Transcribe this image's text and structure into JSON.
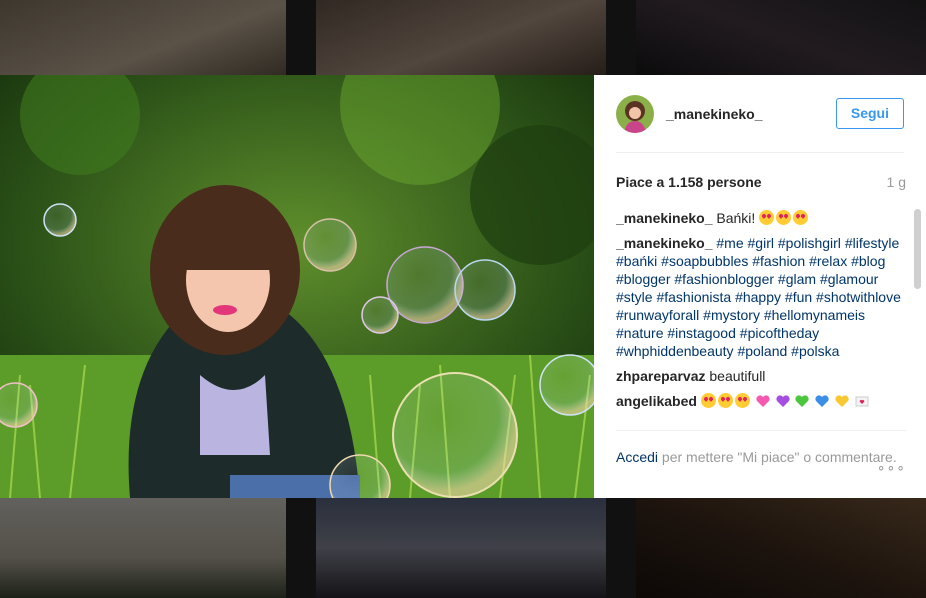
{
  "post": {
    "username": "_manekineko_",
    "follow_label": "Segui",
    "likes": "Piace a 1.158 persone",
    "time": "1 g"
  },
  "comments": [
    {
      "user": "_manekineko_",
      "text": "Bańki!",
      "emoji": [
        "face-heart-eyes",
        "face-heart-eyes",
        "face-heart-eyes"
      ]
    },
    {
      "user": "_manekineko_",
      "tags": [
        "#me",
        "#girl",
        "#polishgirl",
        "#lifestyle",
        "#bańki",
        "#soapbubbles",
        "#fashion",
        "#relax",
        "#blog",
        "#blogger",
        "#fashionblogger",
        "#glam",
        "#glamour",
        "#style",
        "#fashionista",
        "#happy",
        "#fun",
        "#shotwithlove",
        "#runwayforall",
        "#mystory",
        "#hellomynameis",
        "#nature",
        "#instagood",
        "#picoftheday",
        "#whphiddenbeauty",
        "#poland",
        "#polska"
      ]
    },
    {
      "user": "zhpareparvaz",
      "text": "beautifull"
    },
    {
      "user": "angelikabed",
      "emoji": [
        "face-heart-eyes",
        "face-heart-eyes",
        "face-heart-eyes",
        "sparkle-heart",
        "purple-heart",
        "green-heart",
        "blue-heart",
        "yellow-heart",
        "love-letter"
      ]
    }
  ],
  "footer": {
    "login_label": "Accedi",
    "prompt": "per mettere \"Mi piace\" o commentare.",
    "more": "∘∘∘"
  },
  "colors": {
    "link": "#3897f0",
    "hashtag": "#003569",
    "muted": "#999999"
  }
}
